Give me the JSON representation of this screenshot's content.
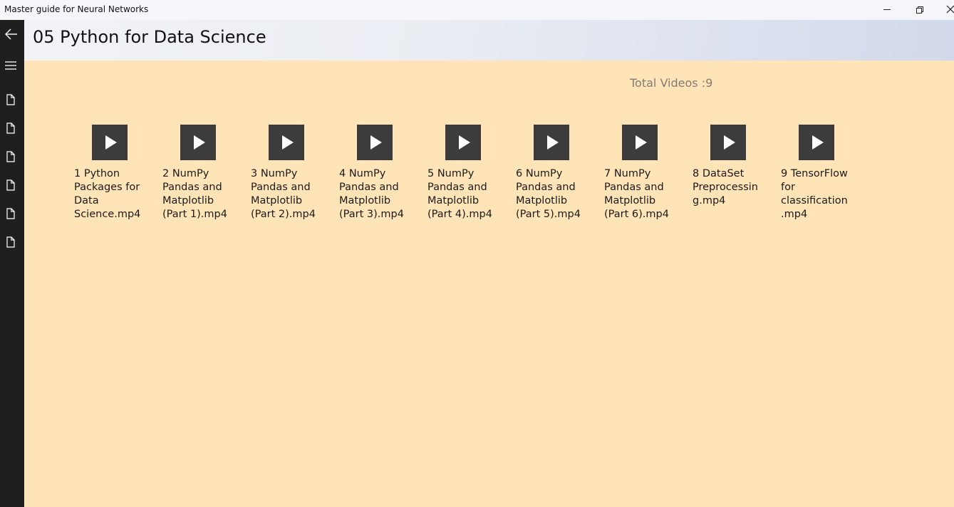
{
  "window": {
    "title": "Master guide for Neural Networks"
  },
  "header": {
    "title": "05 Python for Data Science"
  },
  "content": {
    "total_videos_label": "Total Videos :9"
  },
  "videos": [
    {
      "label": "1 Python Packages for Data Science.mp4"
    },
    {
      "label": "2 NumPy Pandas and Matplotlib (Part 1).mp4"
    },
    {
      "label": "3 NumPy Pandas and Matplotlib (Part 2).mp4"
    },
    {
      "label": "4 NumPy Pandas and Matplotlib (Part 3).mp4"
    },
    {
      "label": "5 NumPy Pandas and Matplotlib (Part 4).mp4"
    },
    {
      "label": "6 NumPy Pandas and Matplotlib (Part 5).mp4"
    },
    {
      "label": "7 NumPy Pandas and Matplotlib (Part 6).mp4"
    },
    {
      "label": "8 DataSet Preprocessing.mp4"
    },
    {
      "label": "9 TensorFlow for classification.mp4"
    }
  ],
  "icons": {
    "back": "arrow-left-icon",
    "menu": "hamburger-menu-icon",
    "document": "document-icon",
    "play": "play-icon"
  },
  "colors": {
    "content_background": "#ffe4b8",
    "sidebar_background": "#1f1f1f",
    "thumbnail_background": "#3c3c3c"
  }
}
